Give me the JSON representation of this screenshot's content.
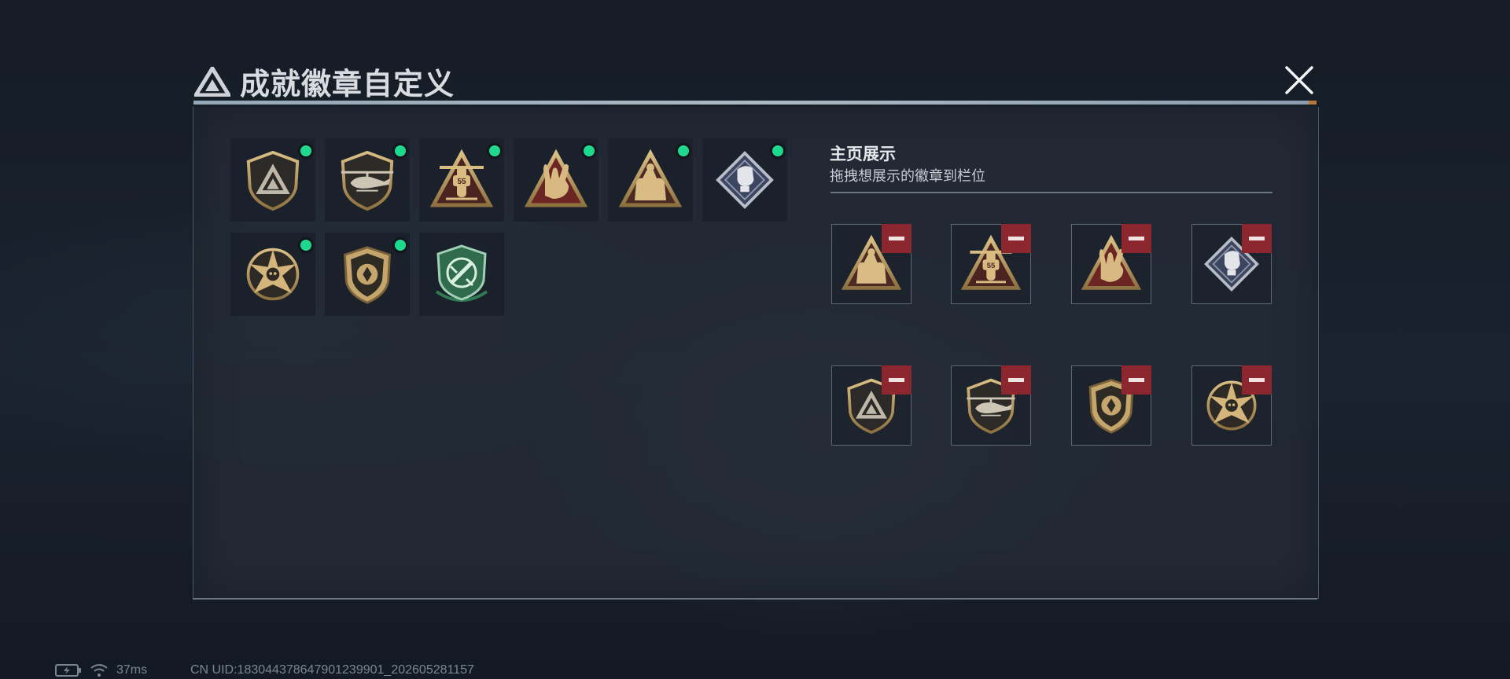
{
  "modal": {
    "title": "成就徽章自定义",
    "close_icon": "close-icon"
  },
  "inventory": {
    "badges": [
      {
        "name": "triangle-shield-badge",
        "equipped": true
      },
      {
        "name": "helicopter-badge",
        "equipped": true
      },
      {
        "name": "55-helicopter-triangle-badge",
        "equipped": true
      },
      {
        "name": "rock-hand-triangle-badge",
        "equipped": true
      },
      {
        "name": "squad-triangle-badge",
        "equipped": true
      },
      {
        "name": "fist-diamond-badge",
        "equipped": true
      },
      {
        "name": "star-skull-badge",
        "equipped": true
      },
      {
        "name": "crest-shield-badge",
        "equipped": true
      },
      {
        "name": "green-knife-shield-badge",
        "equipped": false
      }
    ]
  },
  "showcase": {
    "title": "主页展示",
    "subtitle": "拖拽想展示的徽章到栏位",
    "slots": [
      {
        "badge": "squad-triangle-badge"
      },
      {
        "badge": "55-helicopter-triangle-badge"
      },
      {
        "badge": "rock-hand-triangle-badge"
      },
      {
        "badge": "fist-diamond-badge"
      },
      {
        "badge": "triangle-shield-badge"
      },
      {
        "badge": "helicopter-badge"
      },
      {
        "badge": "crest-shield-badge"
      },
      {
        "badge": "star-skull-badge"
      }
    ]
  },
  "status": {
    "ping": "37ms",
    "uid": "CN UID:183044378647901239901_202605281157"
  },
  "colors": {
    "equipped_dot": "#1fd98f",
    "remove_button": "#8c2730",
    "badge_gold": "#b99a62",
    "badge_green": "#2f6b4c"
  }
}
